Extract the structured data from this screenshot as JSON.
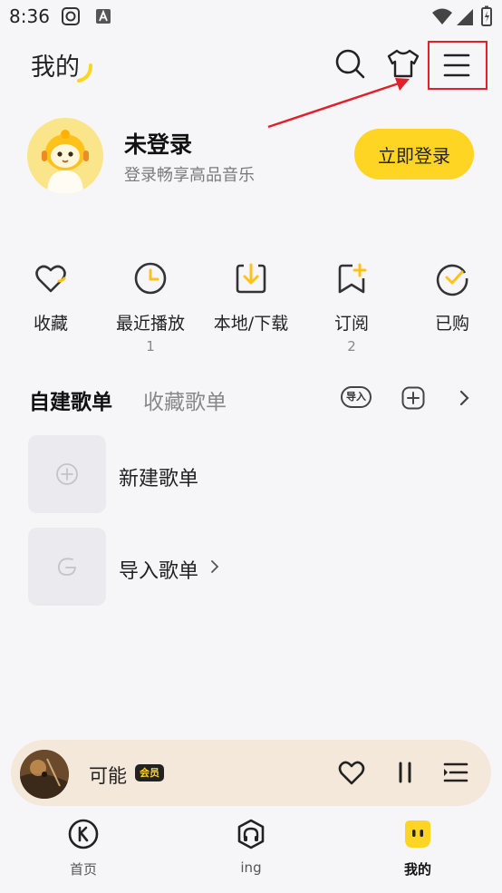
{
  "status_bar": {
    "time": "8:36"
  },
  "header": {
    "title": "我的"
  },
  "profile": {
    "name": "未登录",
    "subtitle": "登录畅享高品音乐",
    "login_button": "立即登录"
  },
  "quick_actions": [
    {
      "label": "收藏",
      "count": ""
    },
    {
      "label": "最近播放",
      "count": "1"
    },
    {
      "label": "本地/下载",
      "count": ""
    },
    {
      "label": "订阅",
      "count": "2"
    },
    {
      "label": "已购",
      "count": ""
    }
  ],
  "playlist_tabs": {
    "active": "自建歌单",
    "inactive": "收藏歌单",
    "import_chip": "导入"
  },
  "playlists": [
    {
      "label": "新建歌单"
    },
    {
      "label": "导入歌单"
    }
  ],
  "mini_player": {
    "title": "可能",
    "badge": "会员"
  },
  "bottom_nav": [
    {
      "label": "首页"
    },
    {
      "label": "ing"
    },
    {
      "label": "我的"
    }
  ],
  "colors": {
    "accent": "#ffd523",
    "background": "#f6f6f9",
    "player_bg": "#f4e8da",
    "highlight": "#e0202a"
  }
}
